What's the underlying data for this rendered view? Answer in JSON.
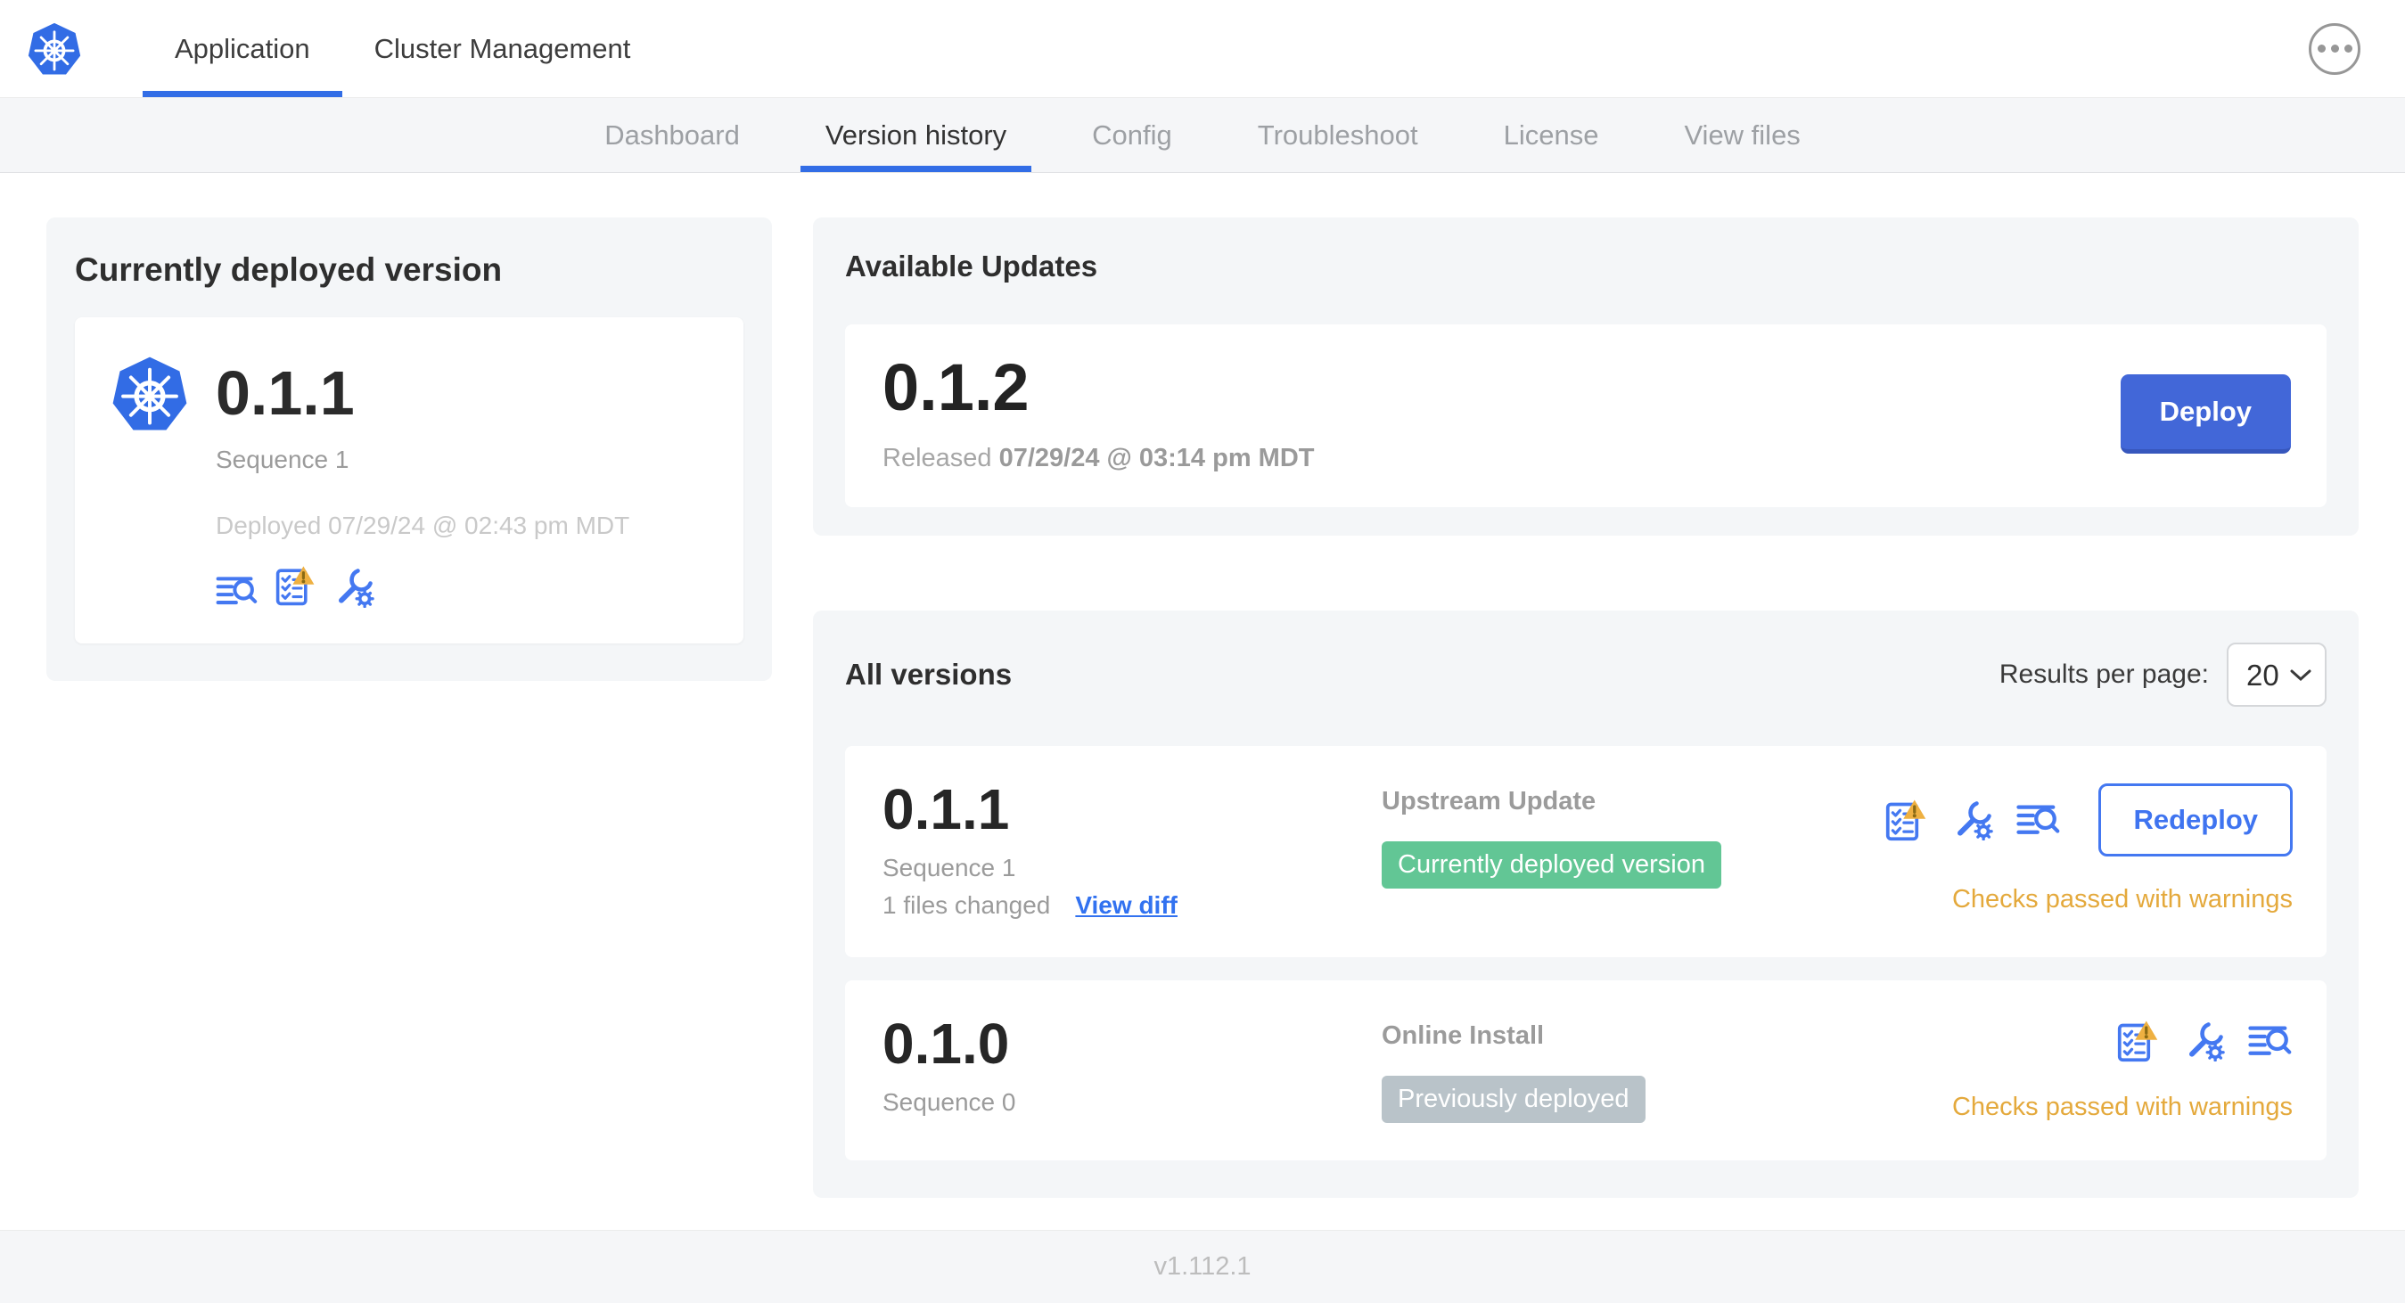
{
  "header": {
    "tabs": [
      {
        "label": "Application",
        "active": true
      },
      {
        "label": "Cluster Management",
        "active": false
      }
    ]
  },
  "subnav": {
    "tabs": [
      {
        "label": "Dashboard",
        "active": false
      },
      {
        "label": "Version history",
        "active": true
      },
      {
        "label": "Config",
        "active": false
      },
      {
        "label": "Troubleshoot",
        "active": false
      },
      {
        "label": "License",
        "active": false
      },
      {
        "label": "View files",
        "active": false
      }
    ]
  },
  "deployed_card": {
    "title": "Currently deployed version",
    "version": "0.1.1",
    "sequence": "Sequence 1",
    "deployed": "Deployed 07/29/24 @ 02:43 pm MDT"
  },
  "available_updates": {
    "title": "Available Updates",
    "version": "0.1.2",
    "released_prefix": "Released",
    "released_date": "07/29/24 @ 03:14 pm MDT",
    "deploy_label": "Deploy"
  },
  "all_versions": {
    "title": "All versions",
    "results_per_page_label": "Results per page:",
    "results_per_page_value": "20",
    "rows": [
      {
        "version": "0.1.1",
        "sequence": "Sequence 1",
        "files_changed": "1 files changed",
        "view_diff_label": "View diff",
        "source": "Upstream Update",
        "badge": "Currently deployed version",
        "badge_color": "green",
        "checks_status": "Checks passed with warnings",
        "action_label": "Redeploy"
      },
      {
        "version": "0.1.0",
        "sequence": "Sequence 0",
        "source": "Online Install",
        "badge": "Previously deployed",
        "badge_color": "gray",
        "checks_status": "Checks passed with warnings"
      }
    ]
  },
  "footer": {
    "app_version": "v1.112.1"
  },
  "colors": {
    "brand_blue": "#326de6",
    "icon_blue": "#4478f1",
    "button_blue": "#4267d8",
    "green_badge": "#62c695",
    "gray_badge": "#b9c3c9",
    "warning_amber": "#e4a93c",
    "panel_gray": "#f4f6f8"
  }
}
